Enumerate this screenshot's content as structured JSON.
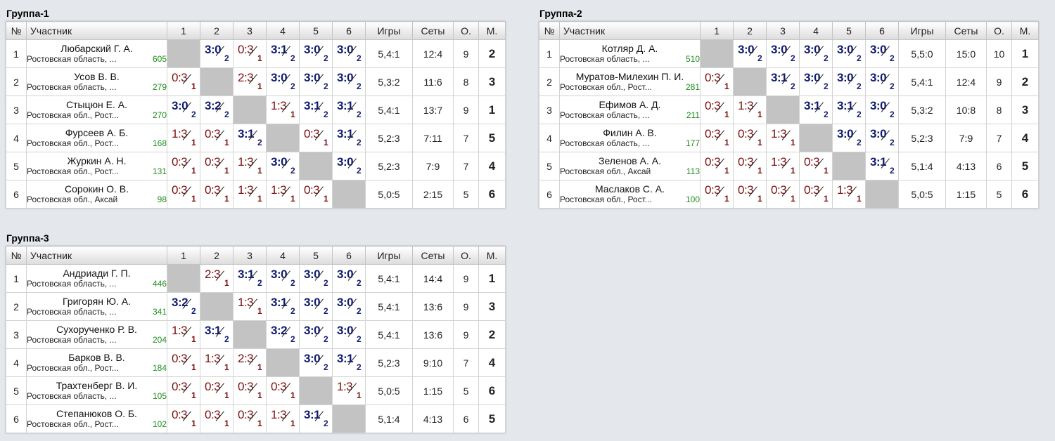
{
  "columns": {
    "num": "№",
    "participant": "Участник",
    "opponents": [
      "1",
      "2",
      "3",
      "4",
      "5",
      "6"
    ],
    "games": "Игры",
    "sets": "Сеты",
    "points": "О.",
    "place": "М."
  },
  "groups": [
    {
      "title": "Группа-1",
      "rows": [
        {
          "num": "1",
          "name": "Любарский Г. А.",
          "region": "Ростовская область, ...",
          "rating": "605",
          "results": [
            null,
            {
              "s": "3:0",
              "p": "2",
              "w": true
            },
            {
              "s": "0:3",
              "p": "1",
              "w": false
            },
            {
              "s": "3:1",
              "p": "2",
              "w": true
            },
            {
              "s": "3:0",
              "p": "2",
              "w": true
            },
            {
              "s": "3:0",
              "p": "2",
              "w": true
            }
          ],
          "games": "5,4:1",
          "sets": "12:4",
          "points": "9",
          "place": "2"
        },
        {
          "num": "2",
          "name": "Усов В. В.",
          "region": "Ростовская область, ...",
          "rating": "279",
          "results": [
            {
              "s": "0:3",
              "p": "1",
              "w": false
            },
            null,
            {
              "s": "2:3",
              "p": "1",
              "w": false
            },
            {
              "s": "3:0",
              "p": "2",
              "w": true
            },
            {
              "s": "3:0",
              "p": "2",
              "w": true
            },
            {
              "s": "3:0",
              "p": "2",
              "w": true
            }
          ],
          "games": "5,3:2",
          "sets": "11:6",
          "points": "8",
          "place": "3"
        },
        {
          "num": "3",
          "name": "Стыцюн Е. А.",
          "region": "Ростовская обл., Рост...",
          "rating": "270",
          "results": [
            {
              "s": "3:0",
              "p": "2",
              "w": true
            },
            {
              "s": "3:2",
              "p": "2",
              "w": true
            },
            null,
            {
              "s": "1:3",
              "p": "1",
              "w": false
            },
            {
              "s": "3:1",
              "p": "2",
              "w": true
            },
            {
              "s": "3:1",
              "p": "2",
              "w": true
            }
          ],
          "games": "5,4:1",
          "sets": "13:7",
          "points": "9",
          "place": "1"
        },
        {
          "num": "4",
          "name": "Фурсеев А. Б.",
          "region": "Ростовская обл., Рост...",
          "rating": "168",
          "results": [
            {
              "s": "1:3",
              "p": "1",
              "w": false
            },
            {
              "s": "0:3",
              "p": "1",
              "w": false
            },
            {
              "s": "3:1",
              "p": "2",
              "w": true
            },
            null,
            {
              "s": "0:3",
              "p": "1",
              "w": false
            },
            {
              "s": "3:1",
              "p": "2",
              "w": true
            }
          ],
          "games": "5,2:3",
          "sets": "7:11",
          "points": "7",
          "place": "5"
        },
        {
          "num": "5",
          "name": "Журкин А. Н.",
          "region": "Ростовская обл., Рост...",
          "rating": "131",
          "results": [
            {
              "s": "0:3",
              "p": "1",
              "w": false
            },
            {
              "s": "0:3",
              "p": "1",
              "w": false
            },
            {
              "s": "1:3",
              "p": "1",
              "w": false
            },
            {
              "s": "3:0",
              "p": "2",
              "w": true
            },
            null,
            {
              "s": "3:0",
              "p": "2",
              "w": true
            }
          ],
          "games": "5,2:3",
          "sets": "7:9",
          "points": "7",
          "place": "4"
        },
        {
          "num": "6",
          "name": "Сорокин О. В.",
          "region": "Ростовская обл., Аксай",
          "rating": "98",
          "results": [
            {
              "s": "0:3",
              "p": "1",
              "w": false
            },
            {
              "s": "0:3",
              "p": "1",
              "w": false
            },
            {
              "s": "1:3",
              "p": "1",
              "w": false
            },
            {
              "s": "1:3",
              "p": "1",
              "w": false
            },
            {
              "s": "0:3",
              "p": "1",
              "w": false
            },
            null
          ],
          "games": "5,0:5",
          "sets": "2:15",
          "points": "5",
          "place": "6"
        }
      ]
    },
    {
      "title": "Группа-2",
      "rows": [
        {
          "num": "1",
          "name": "Котляр Д. А.",
          "region": "Ростовская область, ...",
          "rating": "510",
          "results": [
            null,
            {
              "s": "3:0",
              "p": "2",
              "w": true
            },
            {
              "s": "3:0",
              "p": "2",
              "w": true
            },
            {
              "s": "3:0",
              "p": "2",
              "w": true
            },
            {
              "s": "3:0",
              "p": "2",
              "w": true
            },
            {
              "s": "3:0",
              "p": "2",
              "w": true
            }
          ],
          "games": "5,5:0",
          "sets": "15:0",
          "points": "10",
          "place": "1"
        },
        {
          "num": "2",
          "name": "Муратов-Милехин П. И.",
          "region": "Ростовская обл., Рост...",
          "rating": "281",
          "results": [
            {
              "s": "0:3",
              "p": "1",
              "w": false
            },
            null,
            {
              "s": "3:1",
              "p": "2",
              "w": true
            },
            {
              "s": "3:0",
              "p": "2",
              "w": true
            },
            {
              "s": "3:0",
              "p": "2",
              "w": true
            },
            {
              "s": "3:0",
              "p": "2",
              "w": true
            }
          ],
          "games": "5,4:1",
          "sets": "12:4",
          "points": "9",
          "place": "2"
        },
        {
          "num": "3",
          "name": "Ефимов А. Д.",
          "region": "Ростовская область, ...",
          "rating": "211",
          "results": [
            {
              "s": "0:3",
              "p": "1",
              "w": false
            },
            {
              "s": "1:3",
              "p": "1",
              "w": false
            },
            null,
            {
              "s": "3:1",
              "p": "2",
              "w": true
            },
            {
              "s": "3:1",
              "p": "2",
              "w": true
            },
            {
              "s": "3:0",
              "p": "2",
              "w": true
            }
          ],
          "games": "5,3:2",
          "sets": "10:8",
          "points": "8",
          "place": "3"
        },
        {
          "num": "4",
          "name": "Филин А. В.",
          "region": "Ростовская область, ...",
          "rating": "177",
          "results": [
            {
              "s": "0:3",
              "p": "1",
              "w": false
            },
            {
              "s": "0:3",
              "p": "1",
              "w": false
            },
            {
              "s": "1:3",
              "p": "1",
              "w": false
            },
            null,
            {
              "s": "3:0",
              "p": "2",
              "w": true
            },
            {
              "s": "3:0",
              "p": "2",
              "w": true
            }
          ],
          "games": "5,2:3",
          "sets": "7:9",
          "points": "7",
          "place": "4"
        },
        {
          "num": "5",
          "name": "Зеленов А. А.",
          "region": "Ростовская обл., Аксай",
          "rating": "113",
          "results": [
            {
              "s": "0:3",
              "p": "1",
              "w": false
            },
            {
              "s": "0:3",
              "p": "1",
              "w": false
            },
            {
              "s": "1:3",
              "p": "1",
              "w": false
            },
            {
              "s": "0:3",
              "p": "1",
              "w": false
            },
            null,
            {
              "s": "3:1",
              "p": "2",
              "w": true
            }
          ],
          "games": "5,1:4",
          "sets": "4:13",
          "points": "6",
          "place": "5"
        },
        {
          "num": "6",
          "name": "Маслаков С. А.",
          "region": "Ростовская обл., Рост...",
          "rating": "100",
          "results": [
            {
              "s": "0:3",
              "p": "1",
              "w": false
            },
            {
              "s": "0:3",
              "p": "1",
              "w": false
            },
            {
              "s": "0:3",
              "p": "1",
              "w": false
            },
            {
              "s": "0:3",
              "p": "1",
              "w": false
            },
            {
              "s": "1:3",
              "p": "1",
              "w": false
            },
            null
          ],
          "games": "5,0:5",
          "sets": "1:15",
          "points": "5",
          "place": "6"
        }
      ]
    },
    {
      "title": "Группа-3",
      "rows": [
        {
          "num": "1",
          "name": "Андриади Г. П.",
          "region": "Ростовская область, ...",
          "rating": "446",
          "results": [
            null,
            {
              "s": "2:3",
              "p": "1",
              "w": false
            },
            {
              "s": "3:1",
              "p": "2",
              "w": true
            },
            {
              "s": "3:0",
              "p": "2",
              "w": true
            },
            {
              "s": "3:0",
              "p": "2",
              "w": true
            },
            {
              "s": "3:0",
              "p": "2",
              "w": true
            }
          ],
          "games": "5,4:1",
          "sets": "14:4",
          "points": "9",
          "place": "1"
        },
        {
          "num": "2",
          "name": "Григорян Ю. А.",
          "region": "Ростовская область, ...",
          "rating": "341",
          "results": [
            {
              "s": "3:2",
              "p": "2",
              "w": true
            },
            null,
            {
              "s": "1:3",
              "p": "1",
              "w": false
            },
            {
              "s": "3:1",
              "p": "2",
              "w": true
            },
            {
              "s": "3:0",
              "p": "2",
              "w": true
            },
            {
              "s": "3:0",
              "p": "2",
              "w": true
            }
          ],
          "games": "5,4:1",
          "sets": "13:6",
          "points": "9",
          "place": "3"
        },
        {
          "num": "3",
          "name": "Сухорученко Р. В.",
          "region": "Ростовская область, ...",
          "rating": "204",
          "results": [
            {
              "s": "1:3",
              "p": "1",
              "w": false
            },
            {
              "s": "3:1",
              "p": "2",
              "w": true
            },
            null,
            {
              "s": "3:2",
              "p": "2",
              "w": true
            },
            {
              "s": "3:0",
              "p": "2",
              "w": true
            },
            {
              "s": "3:0",
              "p": "2",
              "w": true
            }
          ],
          "games": "5,4:1",
          "sets": "13:6",
          "points": "9",
          "place": "2"
        },
        {
          "num": "4",
          "name": "Барков В. В.",
          "region": "Ростовская обл., Рост...",
          "rating": "184",
          "results": [
            {
              "s": "0:3",
              "p": "1",
              "w": false
            },
            {
              "s": "1:3",
              "p": "1",
              "w": false
            },
            {
              "s": "2:3",
              "p": "1",
              "w": false
            },
            null,
            {
              "s": "3:0",
              "p": "2",
              "w": true
            },
            {
              "s": "3:1",
              "p": "2",
              "w": true
            }
          ],
          "games": "5,2:3",
          "sets": "9:10",
          "points": "7",
          "place": "4"
        },
        {
          "num": "5",
          "name": "Трахтенберг В. И.",
          "region": "Ростовская область, ...",
          "rating": "105",
          "results": [
            {
              "s": "0:3",
              "p": "1",
              "w": false
            },
            {
              "s": "0:3",
              "p": "1",
              "w": false
            },
            {
              "s": "0:3",
              "p": "1",
              "w": false
            },
            {
              "s": "0:3",
              "p": "1",
              "w": false
            },
            null,
            {
              "s": "1:3",
              "p": "1",
              "w": false
            }
          ],
          "games": "5,0:5",
          "sets": "1:15",
          "points": "5",
          "place": "6"
        },
        {
          "num": "6",
          "name": "Степанюков О. Б.",
          "region": "Ростовская обл., Рост...",
          "rating": "102",
          "results": [
            {
              "s": "0:3",
              "p": "1",
              "w": false
            },
            {
              "s": "0:3",
              "p": "1",
              "w": false
            },
            {
              "s": "0:3",
              "p": "1",
              "w": false
            },
            {
              "s": "1:3",
              "p": "1",
              "w": false
            },
            {
              "s": "3:1",
              "p": "2",
              "w": true
            },
            null
          ],
          "games": "5,1:4",
          "sets": "4:13",
          "points": "6",
          "place": "5"
        }
      ]
    }
  ]
}
